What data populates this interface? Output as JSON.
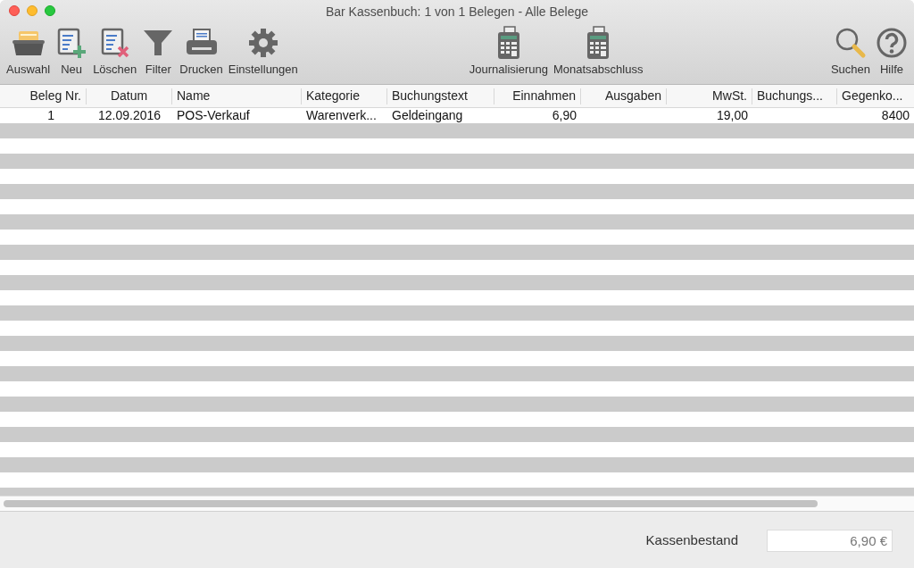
{
  "window": {
    "title": "Bar Kassenbuch: 1 von 1 Belegen - Alle Belege"
  },
  "toolbar": {
    "left": [
      {
        "kind": "tray",
        "label": "Auswahl"
      },
      {
        "kind": "new",
        "label": "Neu"
      },
      {
        "kind": "delete",
        "label": "Löschen"
      },
      {
        "kind": "filter",
        "label": "Filter"
      },
      {
        "kind": "print",
        "label": "Drucken"
      },
      {
        "kind": "gear",
        "label": "Einstellungen"
      }
    ],
    "center": [
      {
        "kind": "calculator",
        "label": "Journalisierung"
      },
      {
        "kind": "calculator",
        "label": "Monatsabschluss"
      }
    ],
    "right": [
      {
        "kind": "search",
        "label": "Suchen"
      },
      {
        "kind": "help",
        "label": "Hilfe"
      }
    ]
  },
  "table": {
    "columns": [
      "Beleg Nr.",
      "Datum",
      "Name",
      "Kategorie",
      "Buchungstext",
      "Einnahmen",
      "Ausgaben",
      "MwSt.",
      "Buchungs...",
      "Gegenko..."
    ],
    "rows": [
      {
        "cells": [
          "1",
          "12.09.2016",
          "POS-Verkauf",
          "Warenverk...",
          "Geldeingang",
          "6,90",
          null,
          "19,00",
          null,
          "8400"
        ]
      }
    ]
  },
  "footer": {
    "label": "Kassenbestand",
    "value": "6,90 €"
  }
}
